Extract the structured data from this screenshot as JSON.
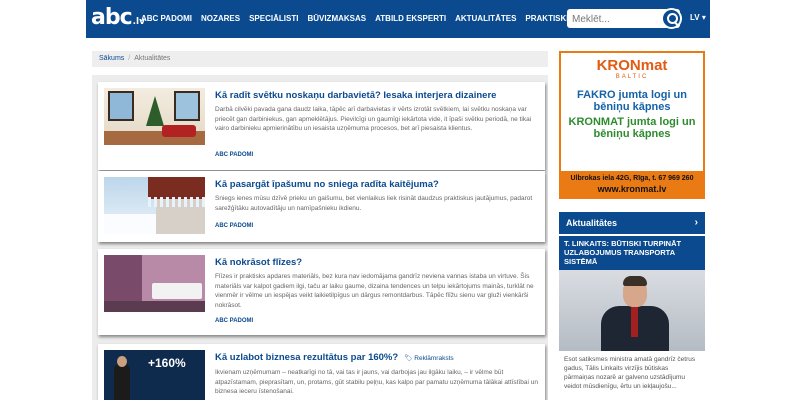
{
  "header": {
    "logo_main": "abc",
    "logo_suffix": ".lv",
    "nav": [
      "ABC PADOMI",
      "NOZARES",
      "SPECIĀLISTI",
      "BŪVIZMAKSAS",
      "ATBILD EKSPERTI",
      "AKTUALITĀTES",
      "PRAKTISKIE PADOMI"
    ],
    "search_placeholder": "Meklēt...",
    "language": "LV"
  },
  "breadcrumb": {
    "home": "Sākums",
    "current": "Aktualitātes"
  },
  "articles": [
    {
      "title": "Kā radīt svētku noskaņu darbavietā? Iesaka interjera dizainere",
      "excerpt": "Darbā cilvēki pavada gana daudz laika, tāpēc arī darbavietas ir vērts izrotāt svētkiem, lai svētku noskaņa var priecēt gan darbiniekus, gan apmeklētājus. Pievilcīgi un gaumīgi iekārtota vide, it īpaši svētku periodā, ne tikai vairo darbinieku apmierinātību un iesaista uzņēmuma procesos, bet arī piesaista klientus.",
      "category": "ABC PADOMI"
    },
    {
      "title": "Kā pasargāt īpašumu no sniega radīta kaitējuma?",
      "excerpt": "Sniegs ienes mūsu dzīvē prieku un gaišumu, bet vienlaikus liek risināt daudzus praktiskus jautājumus, padarot sarežģītāku autovadītāju un namīpašnieku ikdienu.",
      "category": "ABC PADOMI"
    },
    {
      "title": "Kā nokrāsot flīzes?",
      "excerpt": "Flīzes ir praktisks apdares materiāls, bez kura nav iedomājama gandrīz neviena vannas istaba un virtuve. Šis materiāls var kalpot gadiem ilgi, taču ar laiku gaume, dizaina tendences un telpu iekārtojums mainās, turklāt ne vienmēr ir vēlme un iespējas veikt laikietilpīgus un dārgus remontdarbus. Tāpēc flīžu sienu var gluži vienkārši nokrāsot.",
      "category": "ABC PADOMI"
    },
    {
      "title": "Kā uzlabot biznesa rezultātus par 160%?",
      "badge": "Reklāmraksts",
      "thumb_text": "+160%",
      "excerpt": "Ikvienam uzņēmumam – neatkarīgi no tā, vai tas ir jauns, vai darbojas jau ilgāku laiku, – ir vēlme būt atpazīstamam, pieprasītam, un, protams, gūt stabilu peļņu, kas kalpo par pamatu uzņēmuma tālākai attīstībai un biznesa ieceru īstenošanai."
    }
  ],
  "ad": {
    "brand": "KRONmat",
    "brand_sub": "BALTIC",
    "line1": "FAKRO jumta logi un bēniņu kāpnes",
    "line2": "KRONMAT jumta logi un bēniņu kāpnes",
    "address": "Ulbrokas iela 42G, Rīga, t. 67 969 260",
    "url": "www.kronmat.lv",
    "colors": {
      "accent": "#e97a14",
      "blue": "#1462a8",
      "green": "#2e8b2e"
    }
  },
  "sidebar_news": {
    "heading": "Aktualitātes",
    "chevron": "›",
    "item_title": "T. LINKAITS: BŪTISKI TURPINĀT UZLABOJUMUS TRANSPORTA SISTĒMĀ",
    "excerpt": "Esot satiksmes ministra amatā gandrīz četrus gadus, Tālis Linkaits virzījis būtiskas pārmaiņas nozarē ar galveno uzstādījumu veidot mūsdienīgu, ērtu un iekļaujošu..."
  },
  "colors": {
    "brand_blue": "#0b4a8f",
    "feed_bg": "#ececec"
  }
}
